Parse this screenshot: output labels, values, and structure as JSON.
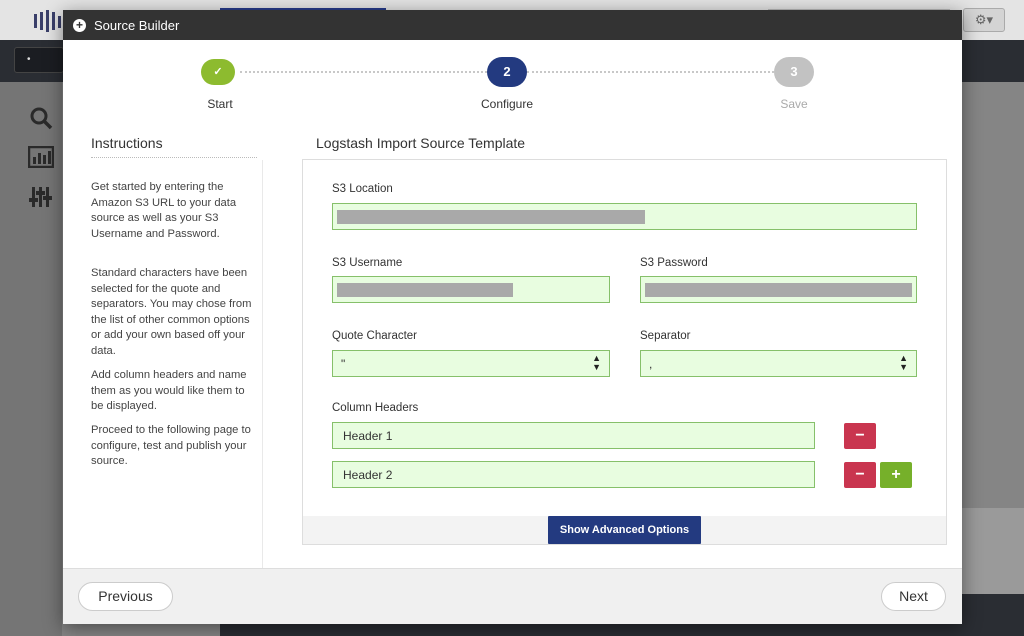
{
  "background": {
    "gear_icon": "⚙▾",
    "nav_pill": "•"
  },
  "modal": {
    "title": "Source Builder",
    "header_icon": "plus-circle-icon"
  },
  "stepper": {
    "steps": [
      {
        "number": "✓",
        "label": "Start",
        "state": "complete",
        "color": "#8dbb2f"
      },
      {
        "number": "2",
        "label": "Configure",
        "state": "active",
        "color": "#233a80"
      },
      {
        "number": "3",
        "label": "Save",
        "state": "pending",
        "color": "#c2c2c2"
      }
    ]
  },
  "instructions": {
    "title": "Instructions",
    "paragraphs": [
      "Get started by entering the Amazon S3 URL to your data source as well as your S3 Username and Password.",
      "Standard characters have been selected for the quote and separators. You may chose from the list of other common options or add your own based off your data.",
      "Add column headers and name them as you would like them to be displayed.",
      "Proceed to the following page to configure, test and publish your source."
    ]
  },
  "form": {
    "title": "Logstash Import Source Template",
    "s3_location_label": "S3 Location",
    "s3_username_label": "S3 Username",
    "s3_password_label": "S3 Password",
    "quote_label": "Quote Character",
    "quote_value": "\"",
    "separator_label": "Separator",
    "separator_value": ",",
    "column_headers_label": "Column Headers",
    "headers": [
      "Header 1",
      "Header 2"
    ],
    "remove_symbol": "−",
    "add_symbol": "+",
    "advanced_button": "Show Advanced Options"
  },
  "footer": {
    "previous": "Previous",
    "next": "Next"
  },
  "colors": {
    "input_bg": "#e8fde0",
    "input_border": "#86c06a",
    "primary": "#233a80",
    "danger": "#c9354f",
    "success": "#76b02a"
  }
}
